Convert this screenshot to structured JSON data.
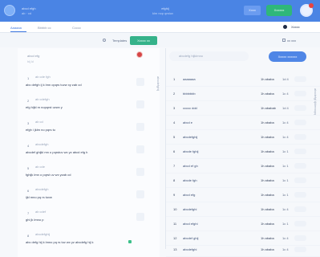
{
  "header": {
    "app_title": "abcd efgh",
    "app_subtitle": "ab · cd",
    "center_title": "efghij",
    "center_subtitle": "klm nop qrstuv",
    "light_button": "Xxxx",
    "primary_button": "Xxxxxx",
    "colors": {
      "bar": "#4a84e4",
      "primary": "#2fb77a",
      "alert": "#e9433f"
    }
  },
  "tabs": {
    "items": [
      {
        "label": "Aaaaaa"
      },
      {
        "label": "Bbbbb cc"
      },
      {
        "label": "Ccccc"
      }
    ],
    "right_label": "Xxxxx"
  },
  "toolbar": {
    "templates": "Templates",
    "action_button": "Xxxxx xx",
    "right_label": "xx xxx"
  },
  "left_panel": {
    "header_line1": "abcd efg",
    "header_line2": "hij kl",
    "messages": [
      {
        "num": "1",
        "who": "ab cde fgh",
        "text": "abc defgh ij k lmn opqrs tuvw xy zab cd"
      },
      {
        "num": "2",
        "who": "ab cdefgh",
        "text": "efg hijkl m nopqrst uvwx y"
      },
      {
        "num": "3",
        "who": "ab cd",
        "text": "efgh i jklm no pqrs tu"
      },
      {
        "num": "4",
        "who": "abcdefgh",
        "text": "abcdef ghijkl mn o pqrstuv wx yz abcd efg h"
      },
      {
        "num": "5",
        "who": "ab cde",
        "text": "fghijk lmn o pqrst uv wx yzab cd"
      },
      {
        "num": "6",
        "who": "abcdefgh",
        "text": "ijkl mno pq rs tuvw"
      },
      {
        "num": "7",
        "who": "ab cdef",
        "text": "ghi jk lmno p"
      },
      {
        "num": "8",
        "who": "abcdefghij",
        "text": "abc defg hij k lmno pq rs tuv wx yz abcdefg hij k"
      }
    ]
  },
  "right_panel": {
    "search_placeholder": "abcdefg hijklmno",
    "button": "Xxxxx xxxxxx",
    "rows": [
      {
        "idx": "1",
        "name": "aaaaaaa",
        "time": "1h ababa",
        "score": "1d 4"
      },
      {
        "idx": "2",
        "name": "bbbbbbb",
        "time": "1h ababa",
        "score": "1c 4"
      },
      {
        "idx": "3",
        "name": "ccccc ddd",
        "time": "1h ababab",
        "score": "1d 4"
      },
      {
        "idx": "4",
        "name": "abcd e",
        "time": "1h ababa",
        "score": "1c 4"
      },
      {
        "idx": "5",
        "name": "abcdefghij",
        "time": "1h ababa",
        "score": "1c 4"
      },
      {
        "idx": "6",
        "name": "abcde fghij",
        "time": "1h ababa",
        "score": "1c 1"
      },
      {
        "idx": "7",
        "name": "abcd ef gh",
        "time": "1h ababa",
        "score": "1c 1"
      },
      {
        "idx": "8",
        "name": "abcde fgh",
        "time": "1h ababa",
        "score": "1c 1"
      },
      {
        "idx": "9",
        "name": "abcd efg",
        "time": "1h ababa",
        "score": "1c 1"
      },
      {
        "idx": "10",
        "name": "abcdefghi",
        "time": "1h ababa",
        "score": "1c 4"
      },
      {
        "idx": "11",
        "name": "abcd efghi",
        "time": "1h ababa",
        "score": "1c 1"
      },
      {
        "idx": "12",
        "name": "abcdef ghij",
        "time": "1h ababa",
        "score": "1c 4"
      },
      {
        "idx": "13",
        "name": "abcdefghi",
        "time": "1h ababa",
        "score": "1c 4"
      }
    ]
  },
  "side_labels": {
    "left_vertical": "abcdefghij",
    "right_vertical": "abcdefghijklmnopq"
  }
}
